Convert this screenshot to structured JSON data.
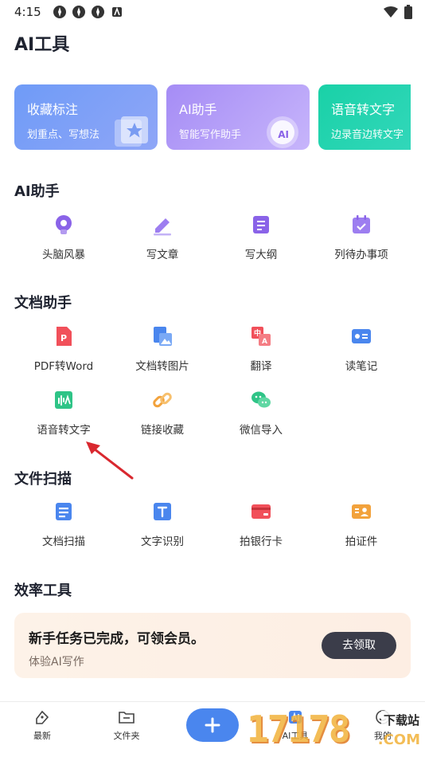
{
  "status": {
    "time": "4:15"
  },
  "page_title": "AI工具",
  "cards": [
    {
      "title": "收藏标注",
      "subtitle": "划重点、写想法"
    },
    {
      "title": "AI助手",
      "subtitle": "智能写作助手",
      "badge": "AI"
    },
    {
      "title": "语音转文字",
      "subtitle": "边录音边转文字"
    }
  ],
  "sections": {
    "ai": {
      "title": "AI助手",
      "items": [
        "头脑风暴",
        "写文章",
        "写大纲",
        "列待办事项"
      ]
    },
    "doc": {
      "title": "文档助手",
      "items": [
        "PDF转Word",
        "文档转图片",
        "翻译",
        "读笔记",
        "语音转文字",
        "链接收藏",
        "微信导入"
      ]
    },
    "scan": {
      "title": "文件扫描",
      "items": [
        "文档扫描",
        "文字识别",
        "拍银行卡",
        "拍证件"
      ]
    },
    "eff": {
      "title": "效率工具"
    }
  },
  "promo": {
    "title": "新手任务已完成，可领会员。",
    "subtitle": "体验AI写作",
    "button": "去领取"
  },
  "nav": {
    "recent": "最新",
    "folder": "文件夹",
    "ai": "AI工具",
    "me": "我的"
  },
  "watermark": {
    "number": "17178",
    "site": "下载站",
    "domain": ".COM"
  },
  "colors": {
    "accent": "#4a86ee",
    "red": "#f1505a",
    "green": "#2fc487",
    "purple": "#8a63e8",
    "orange": "#f2a23c"
  }
}
